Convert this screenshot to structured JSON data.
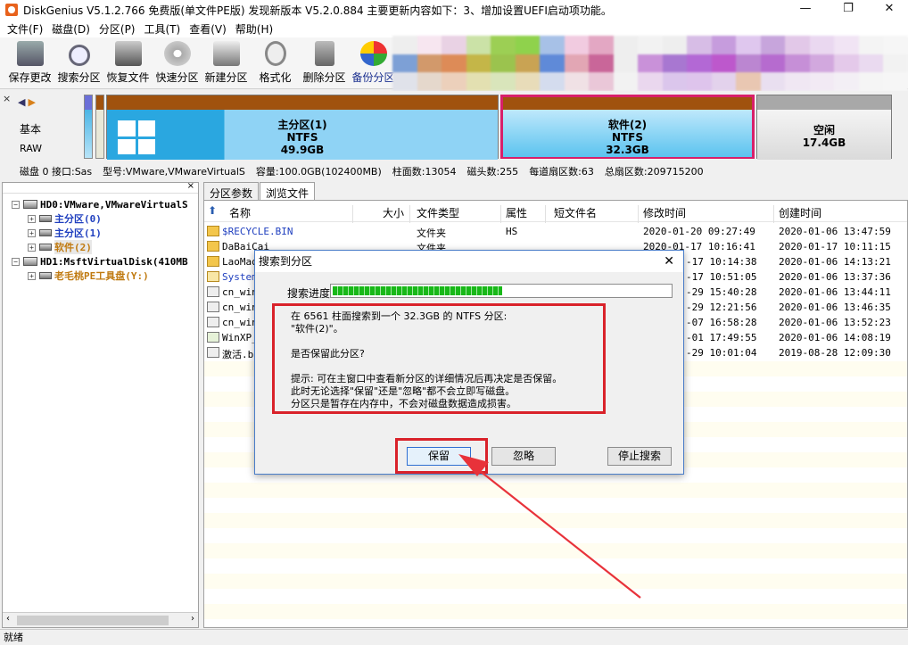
{
  "window": {
    "title": "DiskGenius V5.1.2.766 免费版(单文件PE版)    发现新版本 V5.2.0.884 主要更新内容如下：3、增加设置UEFI启动项功能。",
    "minimize": "—",
    "maximize": "❐",
    "close": "✕"
  },
  "menu": [
    "文件(F)",
    "磁盘(D)",
    "分区(P)",
    "工具(T)",
    "查看(V)",
    "帮助(H)"
  ],
  "toolbar": [
    {
      "label": "保存更改",
      "icon": "save-icon"
    },
    {
      "label": "搜索分区",
      "icon": "search-icon"
    },
    {
      "label": "恢复文件",
      "icon": "recover-icon"
    },
    {
      "label": "快速分区",
      "icon": "quick-partition-icon"
    },
    {
      "label": "新建分区",
      "icon": "new-partition-icon"
    },
    {
      "label": "格式化",
      "icon": "format-icon"
    },
    {
      "label": "删除分区",
      "icon": "delete-icon"
    },
    {
      "label": "备份分区",
      "icon": "backup-icon"
    }
  ],
  "disk_panel": {
    "close": "×",
    "type": "基本",
    "fs": "RAW",
    "partitions": [
      {
        "name": "主分区(1)",
        "fs": "NTFS",
        "size": "49.9GB"
      },
      {
        "name": "软件(2)",
        "fs": "NTFS",
        "size": "32.3GB"
      },
      {
        "name": "空闲",
        "fs": "",
        "size": "17.4GB"
      }
    ]
  },
  "disk_info": [
    "磁盘 0 接口:Sas",
    "型号:VMware,VMwareVirtualS",
    "容量:100.0GB(102400MB)",
    "柱面数:13054",
    "磁头数:255",
    "每道扇区数:63",
    "总扇区数:209715200"
  ],
  "tree": {
    "header_close": "×",
    "items": [
      {
        "label": "HD0:VMware,VMwareVirtualS",
        "color": "#000000"
      },
      {
        "label": "主分区(0)",
        "color": "#1f3fbf"
      },
      {
        "label": "主分区(1)",
        "color": "#1f3fbf"
      },
      {
        "label": "软件(2)",
        "color": "#c07a10"
      },
      {
        "label": "HD1:MsftVirtualDisk(410MB",
        "color": "#000000"
      },
      {
        "label": "老毛桃PE工具盘(Y:)",
        "color": "#c07a10"
      }
    ],
    "scroll_left": "‹",
    "scroll_right": "›"
  },
  "tabs": [
    "分区参数",
    "浏览文件"
  ],
  "file_columns": [
    "名称",
    "大小",
    "文件类型",
    "属性",
    "短文件名",
    "修改时间",
    "创建时间"
  ],
  "files": [
    {
      "name": "$RECYCLE.BIN",
      "type": "文件夹",
      "attr": "HS",
      "modified": "2020-01-20 09:27:49",
      "created": "2020-01-06 13:47:59",
      "icon": "folder",
      "color": "#1f3fbf"
    },
    {
      "name": "DaBaiCai",
      "type": "文件夹",
      "attr": "",
      "modified": "2020-01-17 10:16:41",
      "created": "2020-01-17 10:11:15",
      "icon": "folder",
      "color": "#000000"
    },
    {
      "name": "LaoMao",
      "type": "",
      "attr": "",
      "modified": "-17 10:14:38",
      "created": "2020-01-06 14:13:21",
      "icon": "folder",
      "color": "#000000"
    },
    {
      "name": "System",
      "type": "",
      "attr": "",
      "modified": "-17 10:51:05",
      "created": "2020-01-06 13:37:36",
      "icon": "folder",
      "color": "#1f3fbf"
    },
    {
      "name": "cn_win",
      "type": "",
      "attr": "",
      "modified": "-29 15:40:28",
      "created": "2020-01-06 13:44:11",
      "icon": "file",
      "color": "#000000"
    },
    {
      "name": "cn_win",
      "type": "",
      "attr": "",
      "modified": "-29 12:21:56",
      "created": "2020-01-06 13:46:35",
      "icon": "file",
      "color": "#000000"
    },
    {
      "name": "cn_win",
      "type": "",
      "attr": "",
      "modified": "-07 16:58:28",
      "created": "2020-01-06 13:52:23",
      "icon": "file",
      "color": "#000000"
    },
    {
      "name": "WinXP_",
      "type": "",
      "attr": "",
      "modified": "-01 17:49:55",
      "created": "2020-01-06 14:08:19",
      "icon": "file",
      "color": "#000000"
    },
    {
      "name": "激活.b",
      "type": "",
      "attr": "",
      "modified": "-29 10:01:04",
      "created": "2019-08-28 12:09:30",
      "icon": "file",
      "color": "#000000"
    }
  ],
  "dialog": {
    "title": "搜索到分区",
    "close": "✕",
    "progress_label": "搜索进度:",
    "progress": 0.5,
    "message": [
      "在 6561 柱面搜索到一个 32.3GB 的 NTFS 分区:",
      "\"软件(2)\"。",
      "",
      "是否保留此分区?",
      "",
      "提示: 可在主窗口中查看新分区的详细情况后再决定是否保留。",
      "此时无论选择\"保留\"还是\"忽略\"都不会立即写磁盘。",
      "分区只是暂存在内存中，不会对磁盘数据造成损害。"
    ],
    "buttons": {
      "keep": "保留",
      "ignore": "忽略",
      "stop": "停止搜索"
    }
  },
  "status": "就绪",
  "colors": {
    "highlight": "#d9222a",
    "progress": "#18b818",
    "partition_blue": "#2aa7e0",
    "partition_bar": "#a0520e"
  }
}
